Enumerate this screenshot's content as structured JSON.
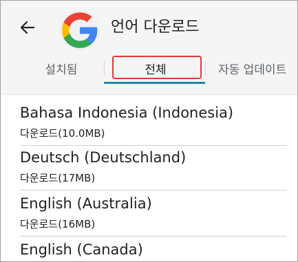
{
  "header": {
    "back_icon": "arrow-left-icon",
    "app_icon": "google-g-logo",
    "title": "언어 다운로드"
  },
  "tabs": [
    {
      "label": "설치됨",
      "selected": false
    },
    {
      "label": "전체",
      "selected": true
    },
    {
      "label": "자동 업데이트",
      "selected": false
    }
  ],
  "languages": [
    {
      "name": "Bahasa Indonesia (Indonesia)",
      "status": "다운로드(10.0MB)"
    },
    {
      "name": "Deutsch (Deutschland)",
      "status": "다운로드(17MB)"
    },
    {
      "name": "English (Australia)",
      "status": "다운로드(16MB)"
    },
    {
      "name": "English (Canada)",
      "status": ""
    }
  ],
  "colors": {
    "accent": "#1e88a8",
    "highlight_box": "#e53935",
    "header_bg": "#f5f5f5"
  }
}
